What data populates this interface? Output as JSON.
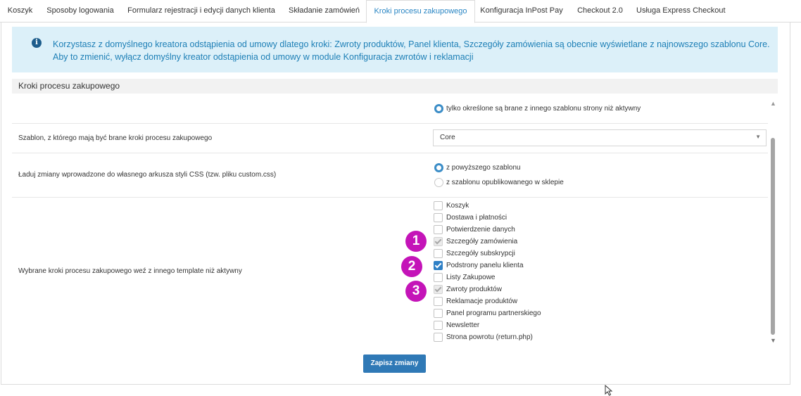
{
  "tabs": [
    {
      "label": "Koszyk"
    },
    {
      "label": "Sposoby logowania"
    },
    {
      "label": "Formularz rejestracji i edycji danych klienta"
    },
    {
      "label": "Składanie zamówień"
    },
    {
      "label": "Kroki procesu zakupowego"
    },
    {
      "label": "Konfiguracja InPost Pay"
    },
    {
      "label": "Checkout 2.0"
    },
    {
      "label": "Usługa Express Checkout"
    }
  ],
  "active_tab": "Kroki procesu zakupowego",
  "alert": {
    "icon": "info-icon",
    "text": "Korzystasz z domyślnego kreatora odstąpienia od umowy dlatego kroki: Zwroty produktów, Panel klienta, Szczegóły zamówienia są obecnie wyświetlane z najnowszego szablonu Core. Aby to zmienić, wyłącz domyślny kreator odstąpienia od umowy w module Konfiguracja zwrotów i reklamacji"
  },
  "section": {
    "title": "Kroki procesu zakupowego"
  },
  "rows": {
    "top_radio": {
      "label": "tylko określone są brane z innego szablonu strony niż aktywny",
      "checked": true
    },
    "template": {
      "label": "Szablon, z którego mają być brane kroki procesu zakupowego",
      "value": "Core"
    },
    "css": {
      "label": "Ładuj zmiany wprowadzone do własnego arkusza styli CSS (tzw. pliku custom.css)",
      "options": [
        {
          "label": "z powyższego szablonu",
          "checked": true
        },
        {
          "label": "z szablonu opublikowanego w sklepie",
          "checked": false
        }
      ]
    },
    "steps": {
      "label": "Wybrane kroki procesu zakupowego weź z innego template niż aktywny",
      "items": [
        {
          "label": "Koszyk",
          "checked": false,
          "disabled": false
        },
        {
          "label": "Dostawa i płatności",
          "checked": false,
          "disabled": false
        },
        {
          "label": "Potwierdzenie danych",
          "checked": false,
          "disabled": false
        },
        {
          "label": "Szczegóły zamówienia",
          "checked": true,
          "disabled": true
        },
        {
          "label": "Szczegóły subskrypcji",
          "checked": false,
          "disabled": false
        },
        {
          "label": "Podstrony panelu klienta",
          "checked": true,
          "disabled": false
        },
        {
          "label": "Listy Zakupowe",
          "checked": false,
          "disabled": false
        },
        {
          "label": "Zwroty produktów",
          "checked": true,
          "disabled": true
        },
        {
          "label": "Reklamacje produktów",
          "checked": false,
          "disabled": false
        },
        {
          "label": "Panel programu partnerskiego",
          "checked": false,
          "disabled": false
        },
        {
          "label": "Newsletter",
          "checked": false,
          "disabled": false
        },
        {
          "label": "Strona powrotu (return.php)",
          "checked": false,
          "disabled": false
        }
      ]
    }
  },
  "badges": [
    "1",
    "2",
    "3"
  ],
  "save_label": "Zapisz zmiany",
  "colors": {
    "accent": "#2f79b6",
    "badge": "#c414b8",
    "alert_bg": "#dcf0f9",
    "alert_text": "#1d7fb6"
  }
}
